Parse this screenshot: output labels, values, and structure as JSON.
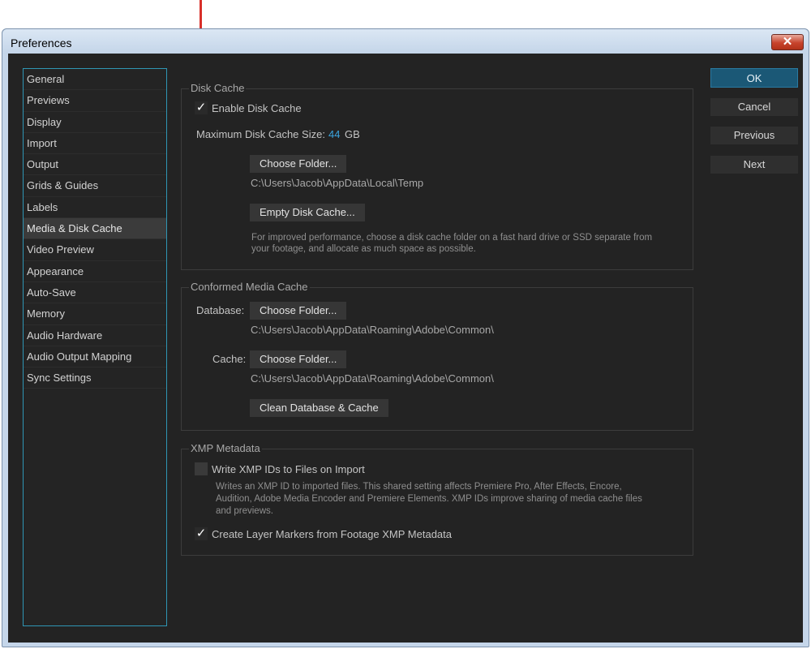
{
  "window": {
    "title": "Preferences",
    "close_glyph": "✕"
  },
  "sidebar": {
    "items": [
      "General",
      "Previews",
      "Display",
      "Import",
      "Output",
      "Grids & Guides",
      "Labels",
      "Media & Disk Cache",
      "Video Preview",
      "Appearance",
      "Auto-Save",
      "Memory",
      "Audio Hardware",
      "Audio Output Mapping",
      "Sync Settings"
    ],
    "selected": "Media & Disk Cache"
  },
  "disk_cache": {
    "label": "Disk Cache",
    "enable_label": "Enable Disk Cache",
    "enable_checked": true,
    "max_size_label": "Maximum Disk Cache Size:",
    "max_size_value": "44",
    "max_size_unit": "GB",
    "choose_folder_label": "Choose Folder...",
    "folder_path": "C:\\Users\\Jacob\\AppData\\Local\\Temp",
    "empty_label": "Empty Disk Cache...",
    "note_line1": "For improved performance, choose a disk cache folder on a fast hard drive or SSD separate from",
    "note_line2": "your footage, and allocate as much space as possible."
  },
  "conformed": {
    "label": "Conformed Media Cache",
    "database_label": "Database:",
    "database_button": "Choose Folder...",
    "database_path": "C:\\Users\\Jacob\\AppData\\Roaming\\Adobe\\Common\\",
    "cache_label": "Cache:",
    "cache_button": "Choose Folder...",
    "cache_path": "C:\\Users\\Jacob\\AppData\\Roaming\\Adobe\\Common\\",
    "clean_label": "Clean Database & Cache"
  },
  "xmp": {
    "label": "XMP Metadata",
    "write_label": "Write XMP IDs to Files on Import",
    "write_checked": false,
    "note_line1": "Writes an XMP ID to imported files. This shared setting affects Premiere Pro, After Effects, Encore,",
    "note_line2": "Audition, Adobe Media Encoder and Premiere Elements. XMP IDs improve sharing of media cache files",
    "note_line3": "and previews.",
    "markers_label": "Create Layer Markers from Footage XMP Metadata",
    "markers_checked": true
  },
  "buttons": {
    "ok": "OK",
    "cancel": "Cancel",
    "previous": "Previous",
    "next": "Next"
  },
  "check_glyph": "✓",
  "colors": {
    "accent": "#2f96b4",
    "primary_button": "#1b5876",
    "annotation_arrow": "#d8302a",
    "size_value": "#3ba5e0"
  }
}
